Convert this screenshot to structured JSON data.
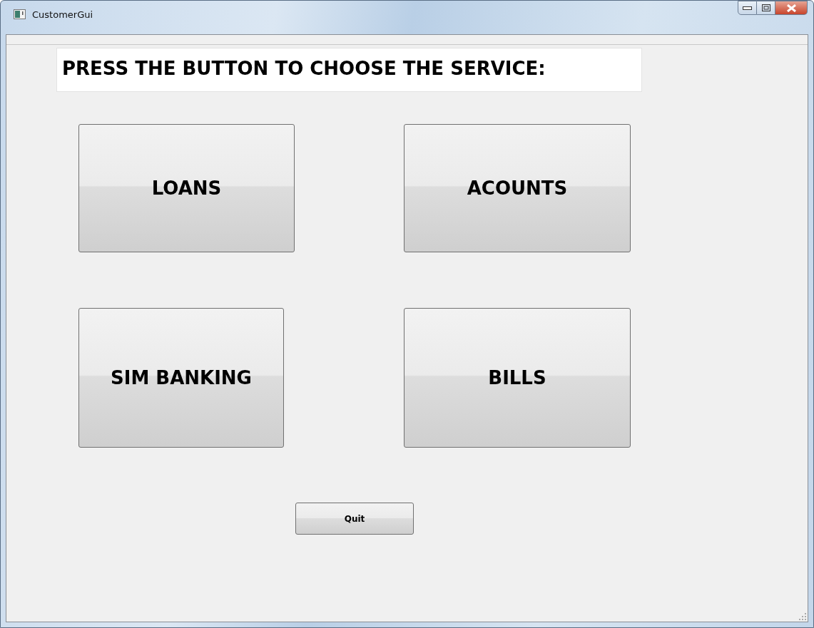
{
  "window": {
    "title": "CustomerGui"
  },
  "heading": "PRESS THE BUTTON TO CHOOSE THE SERVICE:",
  "service_buttons": [
    {
      "label": "LOANS"
    },
    {
      "label": "ACOUNTS"
    },
    {
      "label": "SIM BANKING"
    },
    {
      "label": "BILLS"
    }
  ],
  "quit_button": {
    "label": "Quit"
  }
}
